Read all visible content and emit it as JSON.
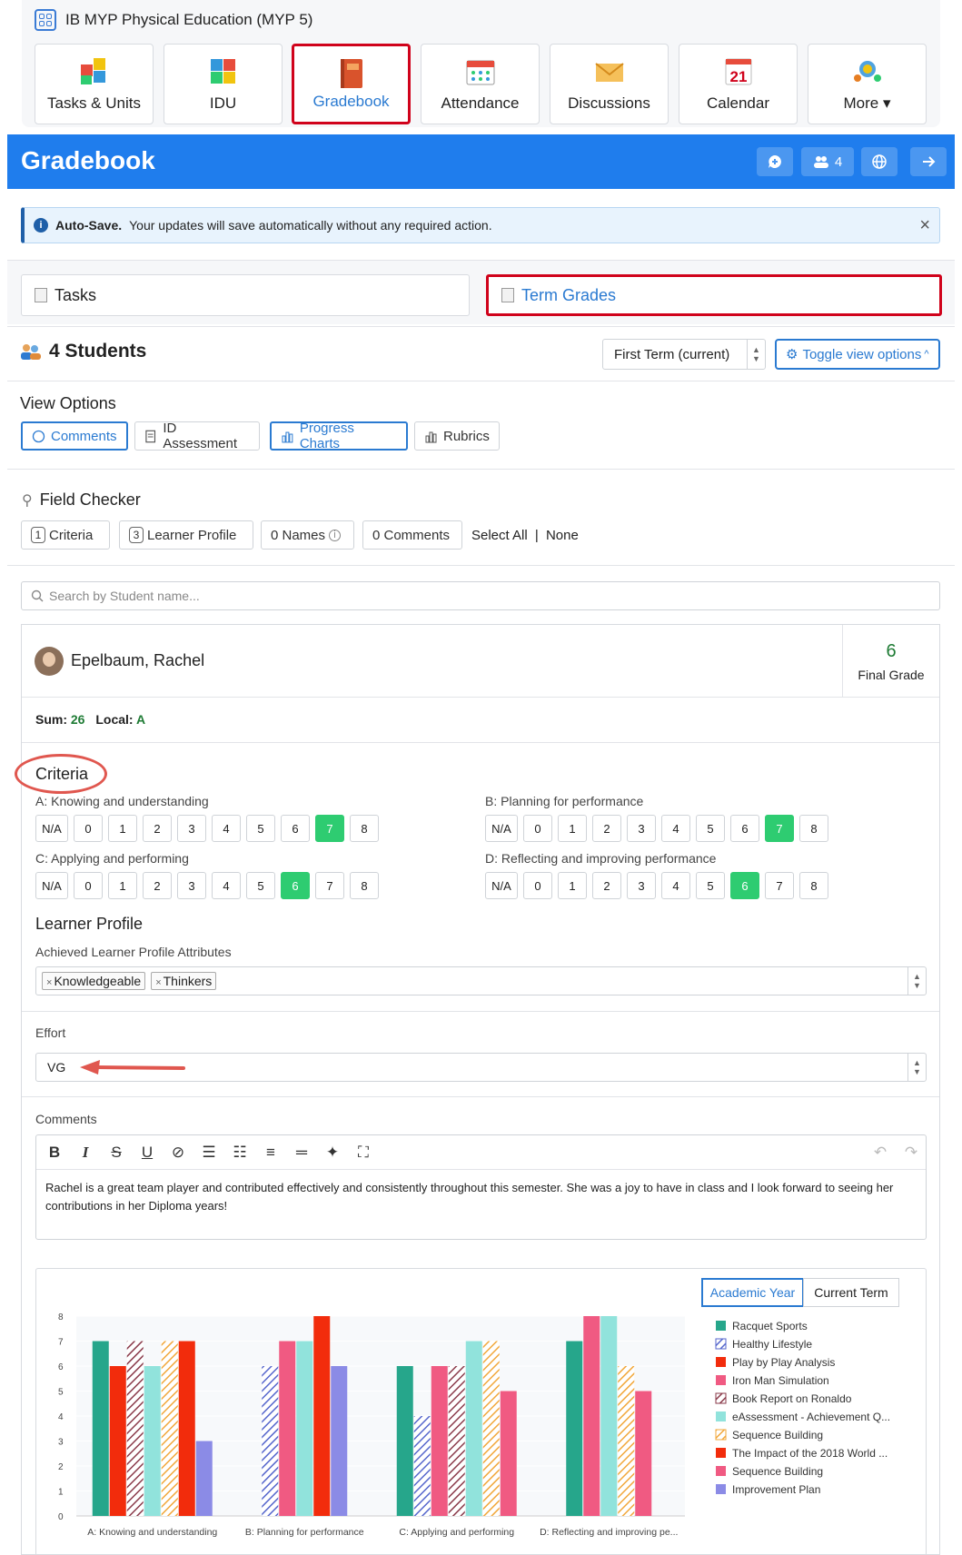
{
  "course": {
    "title": "IB MYP Physical Education (MYP 5)"
  },
  "nav": [
    {
      "label": "Tasks & Units",
      "icon": "puzzle-icon"
    },
    {
      "label": "IDU",
      "icon": "idu-puzzle-icon"
    },
    {
      "label": "Gradebook",
      "icon": "gradebook-book-icon"
    },
    {
      "label": "Attendance",
      "icon": "attendance-calendar-icon"
    },
    {
      "label": "Discussions",
      "icon": "envelope-icon"
    },
    {
      "label": "Calendar",
      "icon": "calendar-icon",
      "day": "21"
    },
    {
      "label": "More",
      "icon": "lightbulb-people-icon"
    }
  ],
  "header": {
    "title": "Gradebook",
    "members_count": "4"
  },
  "autosave": {
    "title": "Auto-Save.",
    "message": "Your updates will save automatically without any required action."
  },
  "tabs": {
    "tasks": "Tasks",
    "term_grades": "Term Grades"
  },
  "students": {
    "label": "4 Students",
    "term": "First Term (current)",
    "toggle": "Toggle view options"
  },
  "view_options": {
    "title": "View Options",
    "buttons": [
      "Comments",
      "ID Assessment",
      "Progress Charts",
      "Rubrics"
    ]
  },
  "field_checker": {
    "title": "Field Checker",
    "criteria_count": "1",
    "criteria_label": "Criteria",
    "lp_count": "3",
    "lp_label": "Learner Profile",
    "names": "0 Names",
    "comments": "0 Comments",
    "select_all": "Select All",
    "sep": "|",
    "none": "None"
  },
  "search": {
    "placeholder": "Search by Student name..."
  },
  "student": {
    "name": "Epelbaum, Rachel",
    "final_grade": "6",
    "final_label": "Final Grade",
    "sum_label": "Sum:",
    "sum": "26",
    "local_label": "Local:",
    "local": "A"
  },
  "criteria": {
    "title": "Criteria",
    "scale": [
      "N/A",
      "0",
      "1",
      "2",
      "3",
      "4",
      "5",
      "6",
      "7",
      "8"
    ],
    "items": [
      {
        "label": "A: Knowing and understanding",
        "selected": "7"
      },
      {
        "label": "B: Planning for performance",
        "selected": "7"
      },
      {
        "label": "C: Applying and performing",
        "selected": "6"
      },
      {
        "label": "D: Reflecting and improving performance",
        "selected": "6"
      }
    ]
  },
  "learner_profile": {
    "title": "Learner Profile",
    "field_label": "Achieved Learner Profile Attributes",
    "chips": [
      "Knowledgeable",
      "Thinkers"
    ]
  },
  "effort": {
    "label": "Effort",
    "value": "VG"
  },
  "comments": {
    "label": "Comments",
    "text": "Rachel is a great team player and contributed effectively and consistently throughout this semester. She was a joy to have in class and I look forward to seeing her contributions in her Diploma years!"
  },
  "chart_toggle": [
    "Academic Year",
    "Current Term"
  ],
  "chart_data": {
    "type": "bar",
    "categories": [
      "A: Knowing and understanding",
      "B: Planning for performance",
      "C: Applying and performing",
      "D: Reflecting and improving pe..."
    ],
    "ylim": [
      0,
      8
    ],
    "yticks": [
      "0",
      "1",
      "2",
      "3",
      "4",
      "5",
      "6",
      "7",
      "8"
    ],
    "series": [
      {
        "name": "Racquet Sports",
        "color": "#26a68b",
        "pattern": "solid",
        "values": [
          7,
          null,
          6,
          7
        ]
      },
      {
        "name": "Healthy Lifestyle",
        "color": "#5566cc",
        "pattern": "hatch",
        "values": [
          null,
          6,
          4,
          null
        ]
      },
      {
        "name": "Play by Play Analysis",
        "color": "#f22c0c",
        "pattern": "solid",
        "values": [
          6,
          null,
          null,
          null
        ]
      },
      {
        "name": "Iron Man Simulation",
        "color": "#f05a82",
        "pattern": "solid",
        "values": [
          null,
          7,
          6,
          8
        ]
      },
      {
        "name": "Book Report on Ronaldo",
        "color": "#8a3a4a",
        "pattern": "hatch",
        "values": [
          7,
          null,
          6,
          null
        ]
      },
      {
        "name": "eAssessment - Achievement Q...",
        "color": "#91e3dc",
        "pattern": "solid",
        "values": [
          6,
          7,
          7,
          8
        ]
      },
      {
        "name": "Sequence Building",
        "color": "#f1a73a",
        "pattern": "hatch",
        "values": [
          7,
          null,
          7,
          6
        ]
      },
      {
        "name": "The Impact of the 2018 World ...",
        "color": "#f22c0c",
        "pattern": "solid",
        "values": [
          7,
          8,
          null,
          null
        ]
      },
      {
        "name": "Sequence Building",
        "color": "#f05a82",
        "pattern": "solid",
        "values": [
          null,
          null,
          5,
          5
        ]
      },
      {
        "name": "Improvement Plan",
        "color": "#8b8be6",
        "pattern": "solid",
        "values": [
          3,
          6,
          null,
          null
        ]
      }
    ]
  }
}
